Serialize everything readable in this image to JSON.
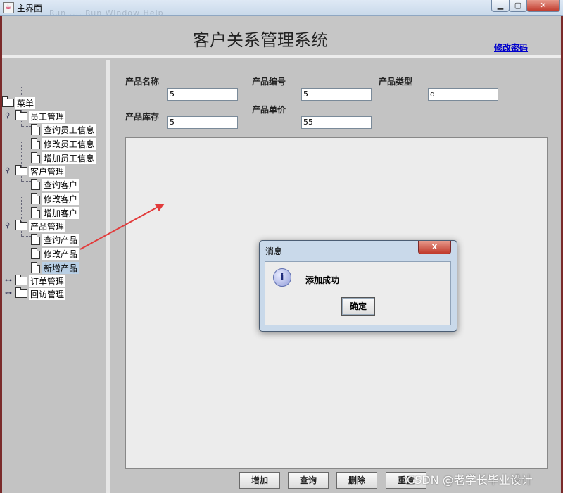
{
  "window": {
    "title": "主界面",
    "ghost_menu": "Run  ....  Run  Window  Help",
    "min_icon": "minimize-icon",
    "max_icon": "maximize-icon",
    "close_icon": "close-icon"
  },
  "header": {
    "system_title": "客户关系管理系统",
    "change_password": "修改密码"
  },
  "tree": {
    "root": "菜单",
    "groups": [
      {
        "label": "员工管理",
        "expanded": true,
        "items": [
          "查询员工信息",
          "修改员工信息",
          "增加员工信息"
        ]
      },
      {
        "label": "客户管理",
        "expanded": true,
        "items": [
          "查询客户",
          "修改客户",
          "增加客户"
        ]
      },
      {
        "label": "产品管理",
        "expanded": true,
        "items": [
          "查询产品",
          "修改产品",
          "新增产品"
        ]
      },
      {
        "label": "订单管理",
        "expanded": false,
        "items": []
      },
      {
        "label": "回访管理",
        "expanded": false,
        "items": []
      }
    ],
    "selected_item": "新增产品"
  },
  "form": {
    "product_name_label": "产品名称",
    "product_name_value": "5",
    "product_code_label": "产品编号",
    "product_code_value": "5",
    "product_type_label": "产品类型",
    "product_type_value": "q",
    "product_stock_label": "产品库存",
    "product_stock_value": "5",
    "product_price_label": "产品单价",
    "product_price_value": "55"
  },
  "buttons": {
    "add": "增加",
    "query": "查询",
    "delete": "删除",
    "reset": "重置"
  },
  "dialog": {
    "title": "消息",
    "close": "x",
    "message": "添加成功",
    "ok": "确定",
    "icon": "info-icon"
  },
  "watermark": "CSDN @老学长毕业设计",
  "colors": {
    "frame_bg": "#c3c3c3",
    "link": "#0000cc",
    "arrow": "#e23b3b",
    "selected_tree_item": "#b8cfe5"
  }
}
